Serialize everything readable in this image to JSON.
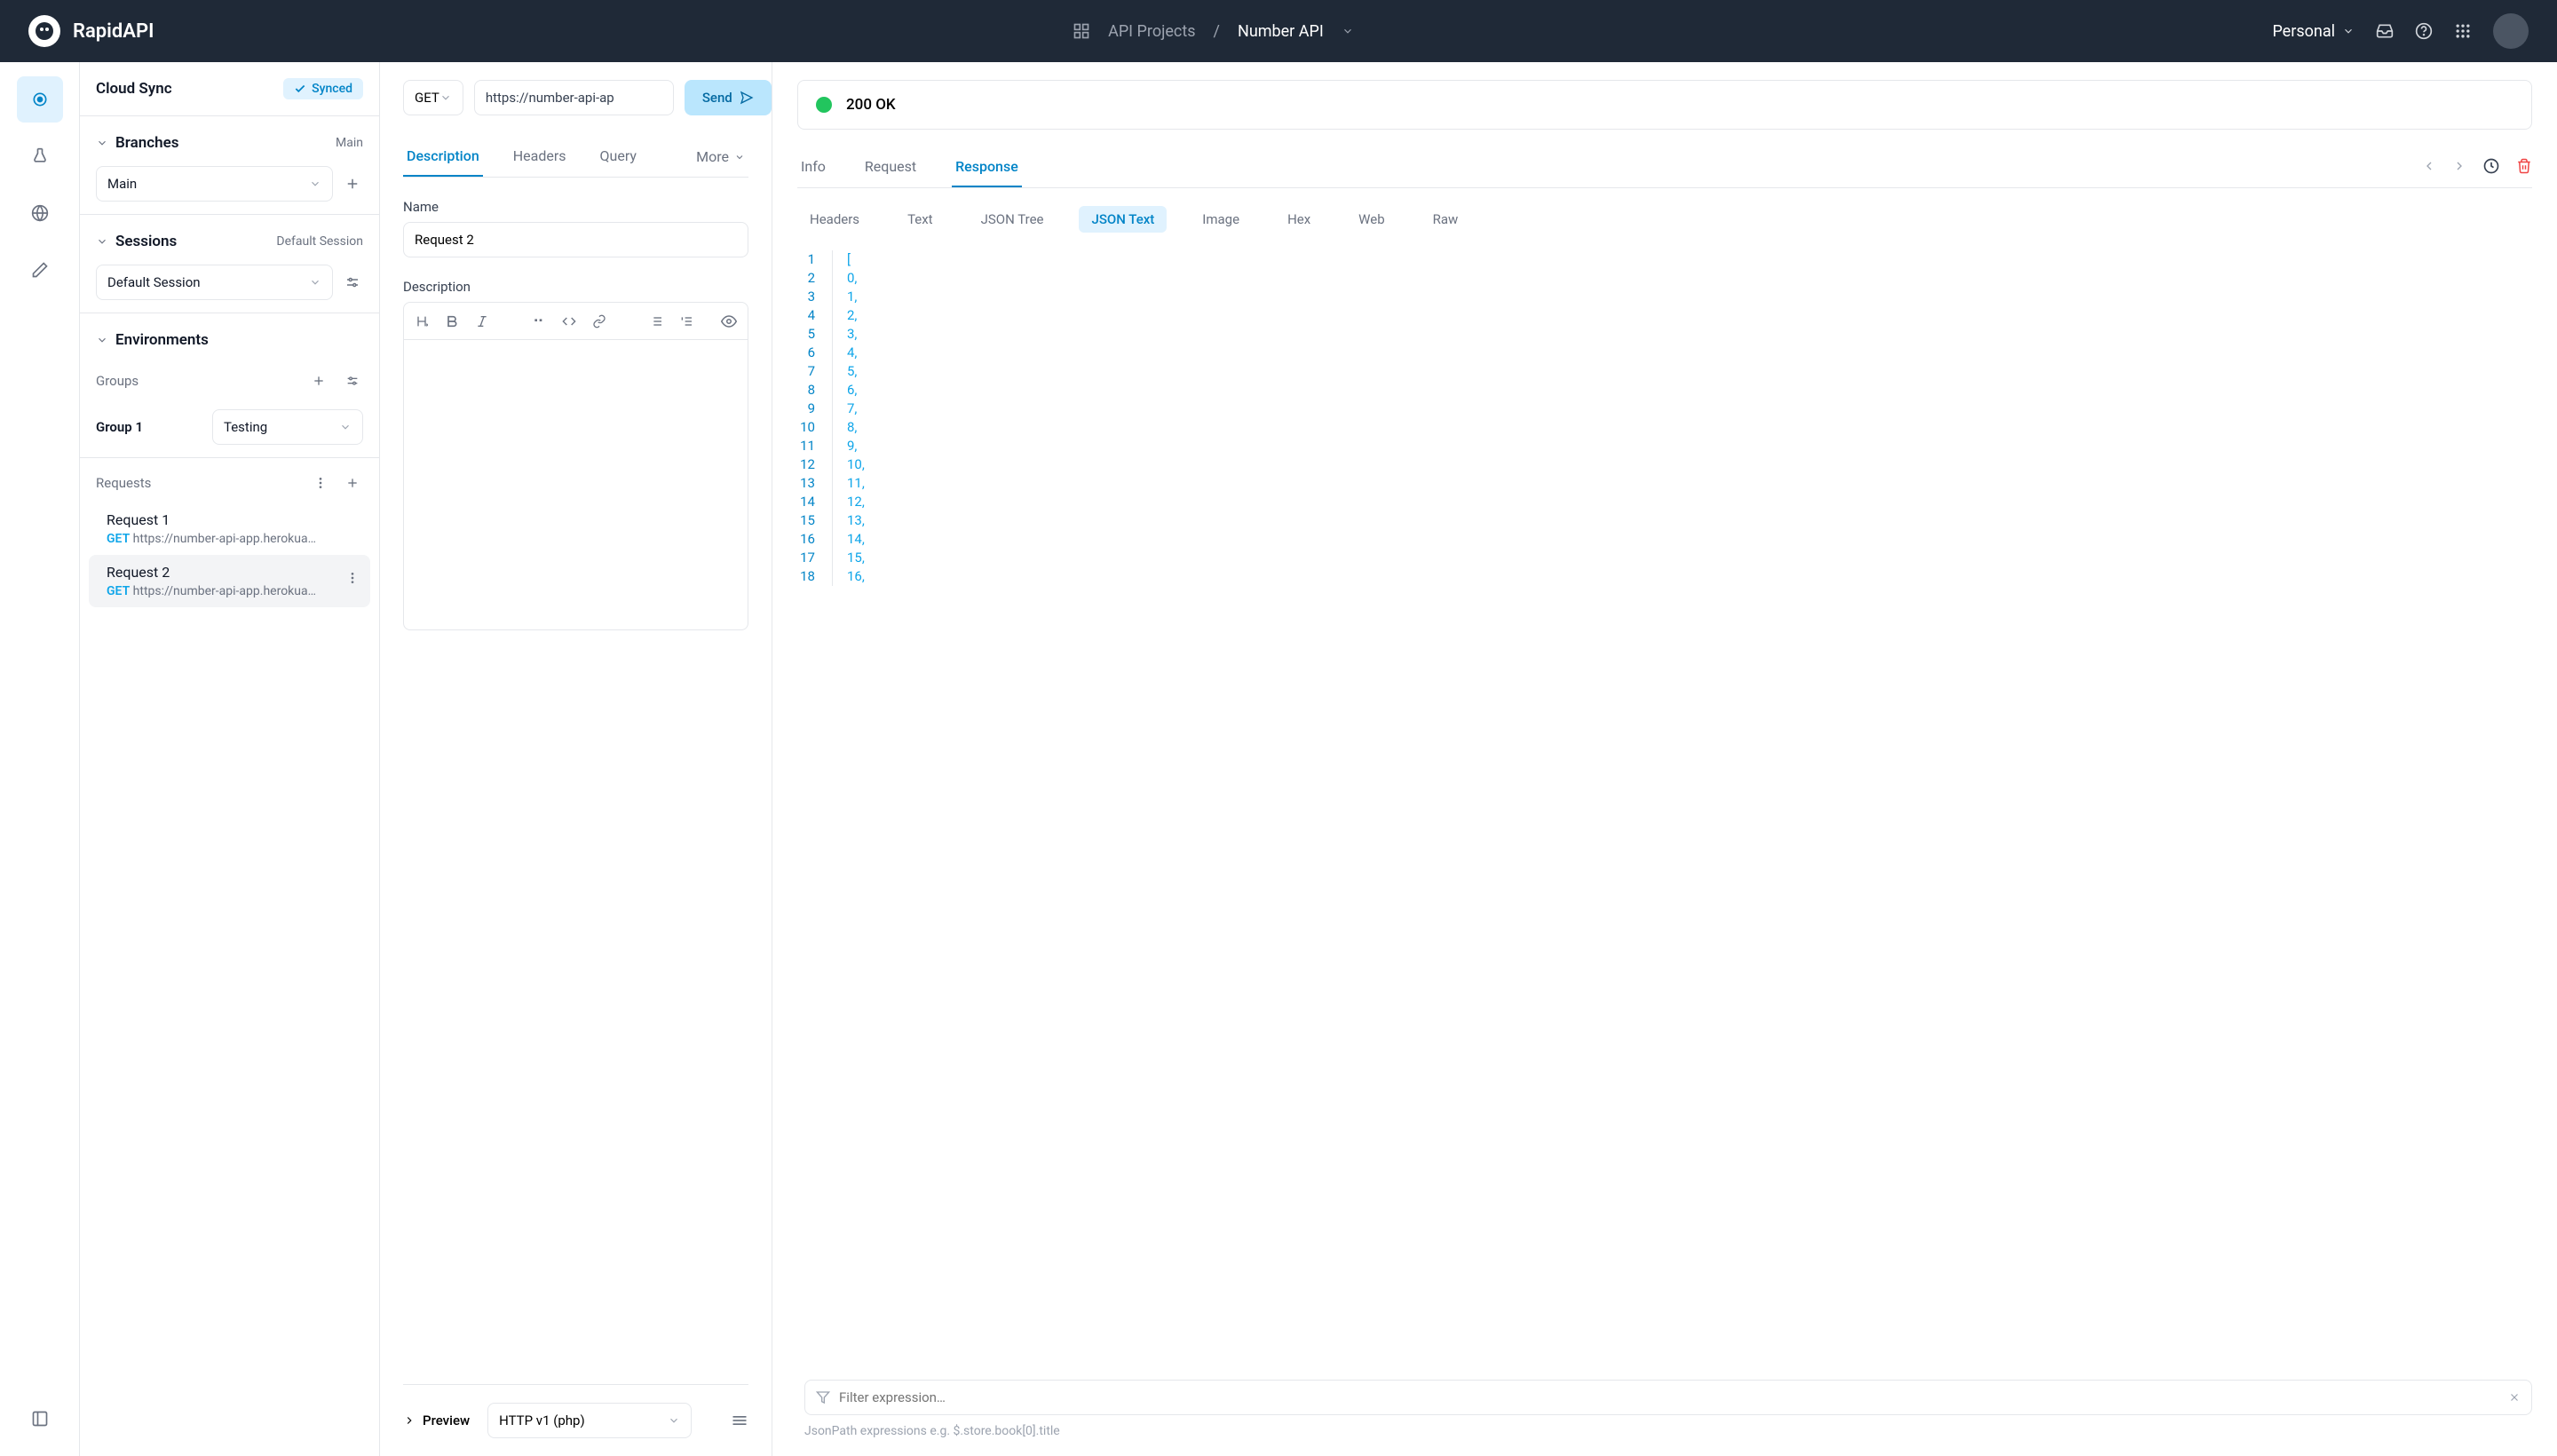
{
  "header": {
    "brand": "RapidAPI",
    "crumb1": "API Projects",
    "crumb2": "Number API",
    "workspace": "Personal"
  },
  "sidebar": {
    "cloud_sync": "Cloud Sync",
    "synced": "Synced",
    "branches": "Branches",
    "branches_status": "Main",
    "branch_selected": "Main",
    "sessions": "Sessions",
    "sessions_status": "Default Session",
    "session_selected": "Default Session",
    "environments": "Environments",
    "groups": "Groups",
    "group1": "Group 1",
    "env_selected": "Testing",
    "requests": "Requests",
    "req1_name": "Request 1",
    "req1_method": "GET",
    "req1_url": "https://number-api-app.herokua…",
    "req2_name": "Request 2",
    "req2_method": "GET",
    "req2_url": "https://number-api-app.herokua…"
  },
  "center": {
    "method": "GET",
    "url": "https://number-api-ap",
    "send": "Send",
    "tab_description": "Description",
    "tab_headers": "Headers",
    "tab_query": "Query",
    "tab_more": "More",
    "name_label": "Name",
    "name_value": "Request 2",
    "desc_label": "Description",
    "preview": "Preview",
    "lang": "HTTP v1 (php)"
  },
  "right": {
    "status": "200 OK",
    "tab_info": "Info",
    "tab_request": "Request",
    "tab_response": "Response",
    "vt_headers": "Headers",
    "vt_text": "Text",
    "vt_json_tree": "JSON Tree",
    "vt_json_text": "JSON Text",
    "vt_image": "Image",
    "vt_hex": "Hex",
    "vt_web": "Web",
    "vt_raw": "Raw",
    "filter_placeholder": "Filter expression…",
    "filter_hint": "JsonPath expressions e.g. $.store.book[0].title"
  },
  "chart_data": {
    "type": "table",
    "title": "JSON response array",
    "lines": [
      {
        "n": 1,
        "txt": "["
      },
      {
        "n": 2,
        "txt": "0,"
      },
      {
        "n": 3,
        "txt": "1,"
      },
      {
        "n": 4,
        "txt": "2,"
      },
      {
        "n": 5,
        "txt": "3,"
      },
      {
        "n": 6,
        "txt": "4,"
      },
      {
        "n": 7,
        "txt": "5,"
      },
      {
        "n": 8,
        "txt": "6,"
      },
      {
        "n": 9,
        "txt": "7,"
      },
      {
        "n": 10,
        "txt": "8,"
      },
      {
        "n": 11,
        "txt": "9,"
      },
      {
        "n": 12,
        "txt": "10,"
      },
      {
        "n": 13,
        "txt": "11,"
      },
      {
        "n": 14,
        "txt": "12,"
      },
      {
        "n": 15,
        "txt": "13,"
      },
      {
        "n": 16,
        "txt": "14,"
      },
      {
        "n": 17,
        "txt": "15,"
      },
      {
        "n": 18,
        "txt": "16,"
      }
    ]
  }
}
